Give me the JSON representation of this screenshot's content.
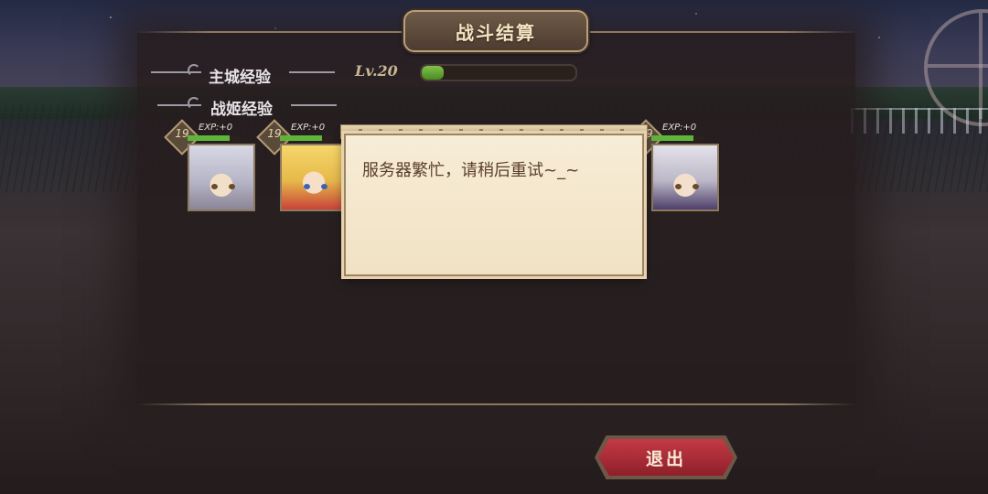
{
  "header": {
    "title": "战斗结算"
  },
  "experience": {
    "castle_label": "主城经验",
    "castle_level": "Lv.20",
    "castle_progress": 0.14,
    "heroine_label": "战姬经验"
  },
  "heroines": [
    {
      "level": "19",
      "exp": "EXP:+0",
      "progress": 0.8,
      "icon": "white-haired-heroine-portrait"
    },
    {
      "level": "19",
      "exp": "EXP:+0",
      "progress": 0.8,
      "icon": "blonde-heroine-portrait"
    },
    {
      "level": "19",
      "exp": "EXP:+0",
      "progress": 0.8,
      "icon": "silver-haired-heroine-portrait"
    }
  ],
  "dialog": {
    "message": "服务器繁忙，请稍后重试~_~"
  },
  "buttons": {
    "exit_label": "退出"
  },
  "colors": {
    "accent_gold": "#b9a07b",
    "exit_red": "#c43a45",
    "xp_green": "#5fb53a"
  }
}
